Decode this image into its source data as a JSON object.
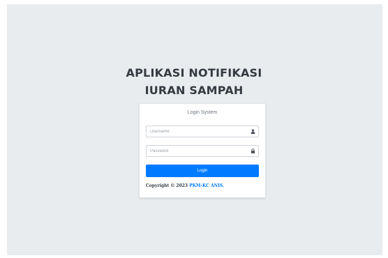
{
  "app": {
    "title_line1": "APLIKASI NOTIFIKASI",
    "title_line2": "IURAN SAMPAH"
  },
  "login": {
    "heading": "Login System",
    "username": {
      "value": "",
      "placeholder": "Username",
      "icon": "user-icon"
    },
    "password": {
      "value": "",
      "placeholder": "Password",
      "icon": "lock-icon"
    },
    "button_label": "Login"
  },
  "footer": {
    "copyright_prefix": "Copyright © 2023 ",
    "link_text": "PKM-KC ANIS."
  },
  "colors": {
    "background": "#e9ecef",
    "primary": "#007bff",
    "title_text": "#343a40"
  }
}
